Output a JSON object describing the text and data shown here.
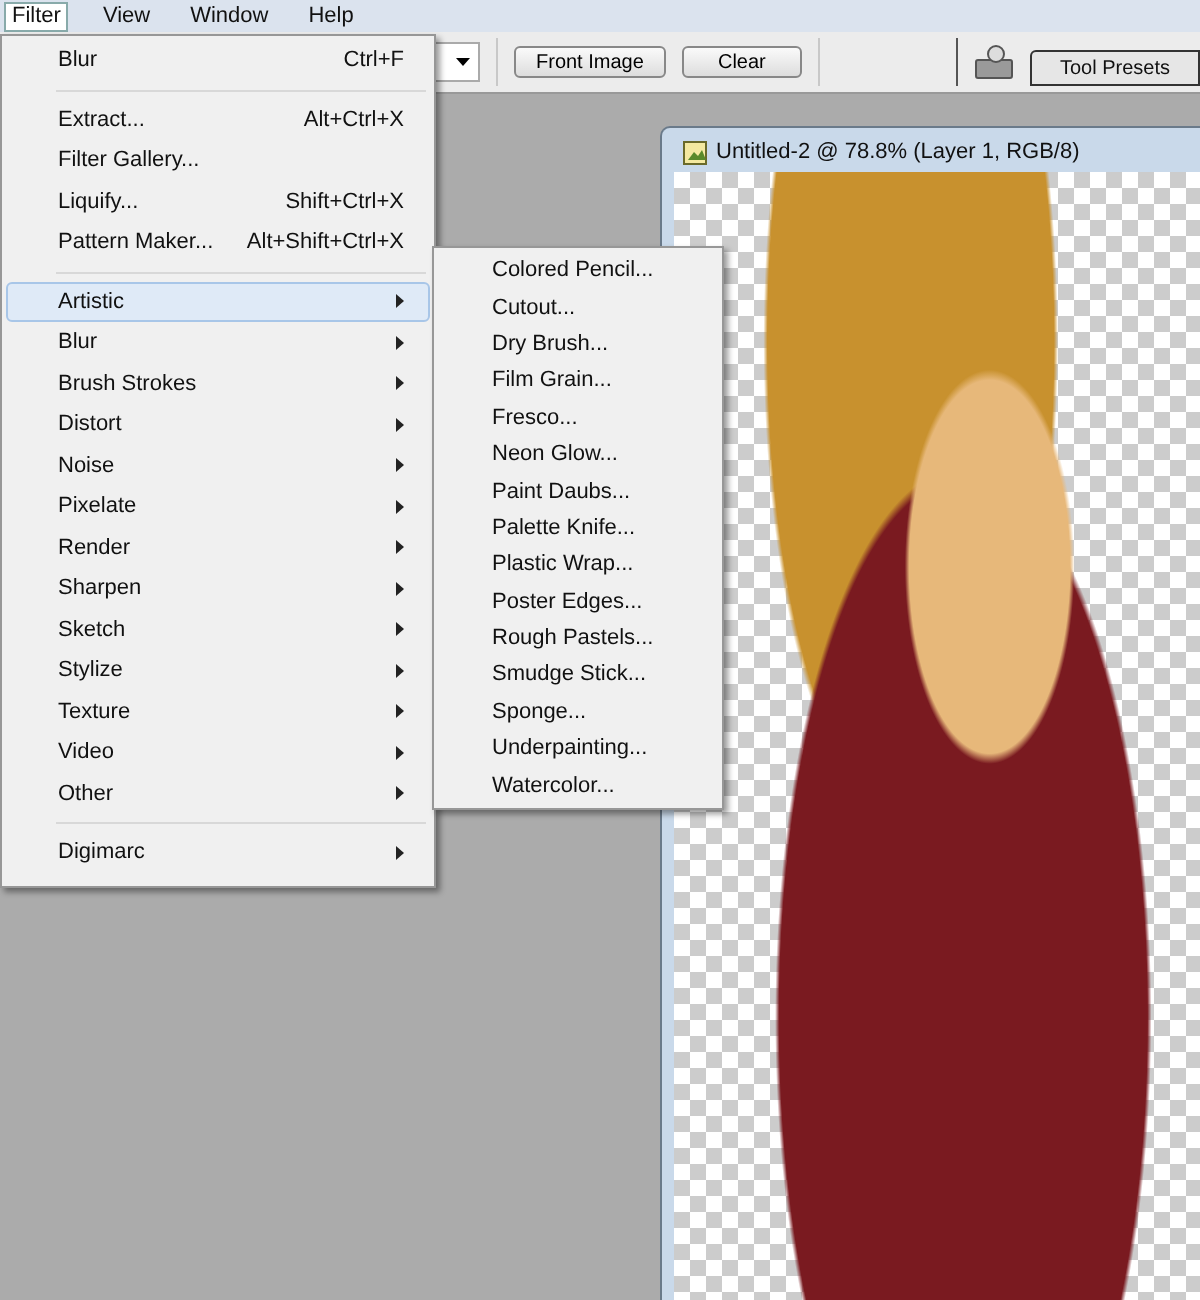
{
  "menubar": [
    {
      "label": "Filter",
      "selected": true
    },
    {
      "label": "View",
      "selected": false
    },
    {
      "label": "Window",
      "selected": false
    },
    {
      "label": "Help",
      "selected": false
    }
  ],
  "options_bar": {
    "buttons": [
      "Front Image",
      "Clear"
    ],
    "tab": "Tool Presets"
  },
  "document": {
    "title": "Untitled-2 @ 78.8% (Layer 1, RGB/8)"
  },
  "filter_menu": {
    "items": [
      {
        "kind": "item",
        "label": "Blur",
        "shortcut": "Ctrl+F"
      },
      {
        "kind": "separator"
      },
      {
        "kind": "item",
        "label": "Extract...",
        "shortcut": "Alt+Ctrl+X"
      },
      {
        "kind": "item",
        "label": "Filter Gallery..."
      },
      {
        "kind": "item",
        "label": "Liquify...",
        "shortcut": "Shift+Ctrl+X"
      },
      {
        "kind": "item",
        "label": "Pattern Maker...",
        "shortcut": "Alt+Shift+Ctrl+X"
      },
      {
        "kind": "separator"
      },
      {
        "kind": "submenu",
        "label": "Artistic",
        "selected": true
      },
      {
        "kind": "submenu",
        "label": "Blur",
        "selected": false
      },
      {
        "kind": "submenu",
        "label": "Brush Strokes",
        "selected": false
      },
      {
        "kind": "submenu",
        "label": "Distort",
        "selected": false
      },
      {
        "kind": "submenu",
        "label": "Noise",
        "selected": false
      },
      {
        "kind": "submenu",
        "label": "Pixelate",
        "selected": false
      },
      {
        "kind": "submenu",
        "label": "Render",
        "selected": false
      },
      {
        "kind": "submenu",
        "label": "Sharpen",
        "selected": false
      },
      {
        "kind": "submenu",
        "label": "Sketch",
        "selected": false
      },
      {
        "kind": "submenu",
        "label": "Stylize",
        "selected": false
      },
      {
        "kind": "submenu",
        "label": "Texture",
        "selected": false
      },
      {
        "kind": "submenu",
        "label": "Video",
        "selected": false
      },
      {
        "kind": "submenu",
        "label": "Other",
        "selected": false
      },
      {
        "kind": "separator"
      },
      {
        "kind": "submenu",
        "label": "Digimarc",
        "selected": false
      }
    ]
  },
  "artistic_submenu": {
    "items": [
      "Colored Pencil...",
      "Cutout...",
      "Dry Brush...",
      "Film Grain...",
      "Fresco...",
      "Neon Glow...",
      "Paint Daubs...",
      "Palette Knife...",
      "Plastic Wrap...",
      "Poster Edges...",
      "Rough Pastels...",
      "Smudge Stick...",
      "Sponge...",
      "Underpainting...",
      "Watercolor..."
    ]
  }
}
